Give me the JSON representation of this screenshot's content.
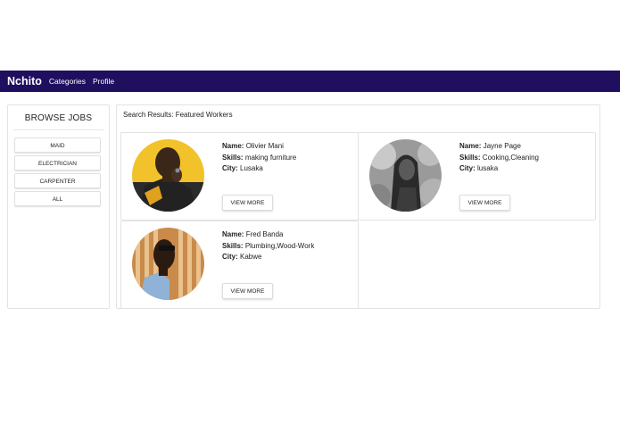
{
  "navbar": {
    "brand": "Nchito",
    "links": [
      "Categories",
      "Profile"
    ],
    "color": "#1f0f5e"
  },
  "sidebar": {
    "title": "BROWSE JOBS",
    "buttons": [
      "MAID",
      "ELECTRICIAN",
      "CARPENTER",
      "ALL"
    ]
  },
  "results": {
    "heading": "Search Results: Featured Workers",
    "labels": {
      "name": "Name:",
      "skills": "Skills:",
      "city": "City:"
    },
    "view_more": "VIEW MORE",
    "workers": [
      {
        "name": "Olivier Mani",
        "skills": "making furniture",
        "city": "Lusaka"
      },
      {
        "name": "Jayne Page",
        "skills": "Cooking,Cleaning",
        "city": "lusaka"
      },
      {
        "name": "Fred Banda",
        "skills": "Plumbing,Wood-Work",
        "city": "Kabwe"
      }
    ]
  }
}
